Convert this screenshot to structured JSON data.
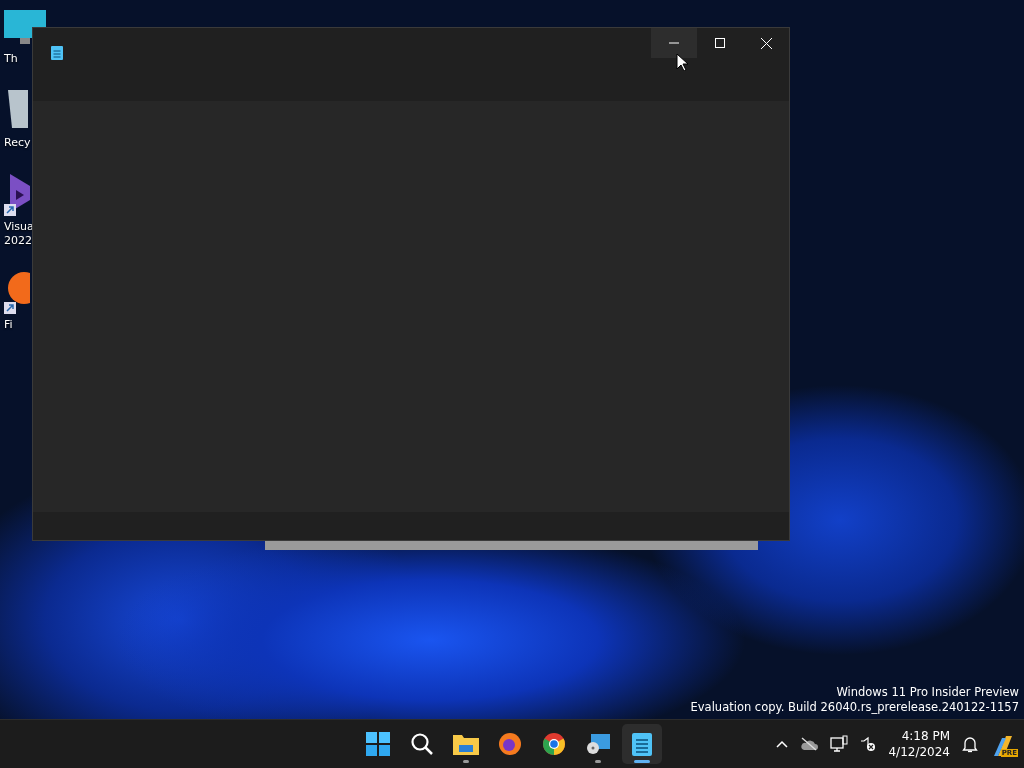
{
  "desktop_icons": [
    {
      "kind": "monitor",
      "label": "Th",
      "shortcut": false
    },
    {
      "kind": "bin",
      "label": "Recy",
      "shortcut": false
    },
    {
      "kind": "vs",
      "label": "Visua\n2022",
      "shortcut": true
    },
    {
      "kind": "firefox",
      "label": "Fi",
      "shortcut": true
    }
  ],
  "window": {
    "active": false
  },
  "watermark_lines": [
    "Windows 11 Pro Insider Preview",
    "Evaluation copy. Build 26040.rs_prerelease.240122-1157"
  ],
  "taskbar": {
    "apps": [
      {
        "kind": "start",
        "running": false,
        "selected": false
      },
      {
        "kind": "search",
        "running": false,
        "selected": false
      },
      {
        "kind": "explorer",
        "running": true,
        "selected": false
      },
      {
        "kind": "firefox",
        "running": false,
        "selected": false
      },
      {
        "kind": "chrome",
        "running": false,
        "selected": false
      },
      {
        "kind": "remote",
        "running": true,
        "selected": false
      },
      {
        "kind": "notepad",
        "running": true,
        "selected": true
      }
    ],
    "time": "4:18 PM",
    "date": "4/12/2024",
    "badge": "PRE"
  }
}
